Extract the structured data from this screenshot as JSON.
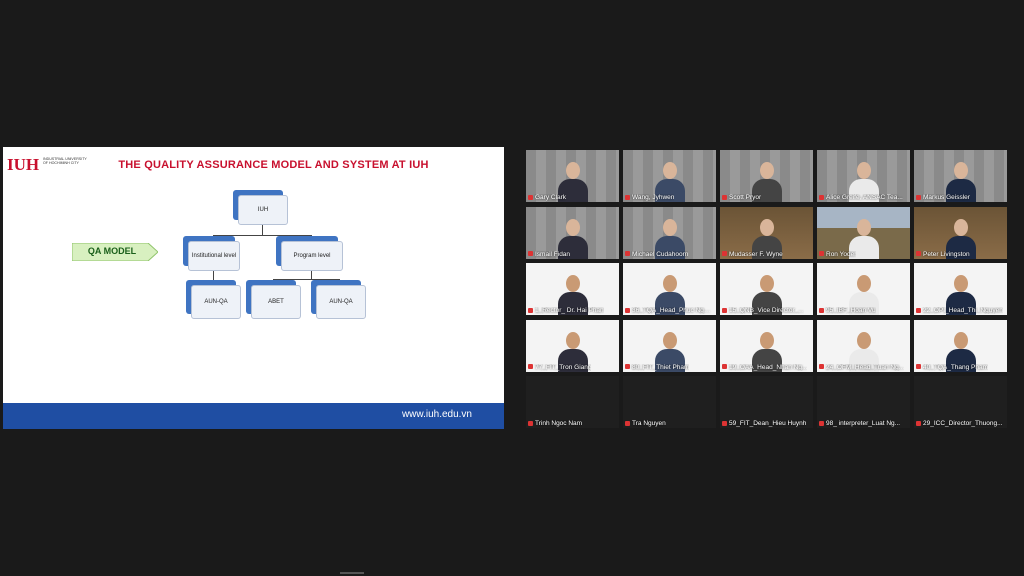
{
  "slide": {
    "title": "THE QUALITY ASSURANCE MODEL AND  SYSTEM AT IUH",
    "logo_text": "INDUSTRIAL UNIVERSITY OF HOCHIMINH CITY",
    "logo_mark": "IUH",
    "qa_model": "QA MODEL",
    "boxes": {
      "root": "IUH",
      "institutional": "Institutional level",
      "program": "Program level",
      "aun_left": "AUN-QA",
      "abet": "ABET",
      "aun_right": "AUN-QA"
    },
    "footer": "www.iuh.edu.vn"
  },
  "participants": [
    {
      "name": "Gary Clark",
      "type": "panel"
    },
    {
      "name": "Wang, Jyhwen",
      "type": "panel"
    },
    {
      "name": "Scott Pryor",
      "type": "panel"
    },
    {
      "name": "Alice Greife, ANSAC Tea...",
      "type": "panel"
    },
    {
      "name": "Markus Geissler",
      "type": "panel"
    },
    {
      "name": "Ismail Fidan",
      "type": "panel"
    },
    {
      "name": "Michael Cudahoorn",
      "type": "panel"
    },
    {
      "name": "Mudasser F. Wyne",
      "type": "room"
    },
    {
      "name": "Ron Yoder",
      "type": "outdoor"
    },
    {
      "name": "Peter Livingston",
      "type": "room"
    },
    {
      "name": "1_Rector_ Dr. Hai Phan",
      "type": "iuh"
    },
    {
      "name": "36_TQA_Head_Phuc Nguyen",
      "type": "iuh"
    },
    {
      "name": "15_QNB_Vice Director_...",
      "type": "iuh"
    },
    {
      "name": "95_IBF_Hoan Vu",
      "type": "iuh"
    },
    {
      "name": "22_OPI_Head_Thi_Nguyen",
      "type": "iuh"
    },
    {
      "name": "77_FIT_Tron Giang",
      "type": "iuh"
    },
    {
      "name": "80_FIT_Thiet Pham",
      "type": "iuh"
    },
    {
      "name": "19_OAA_Head_Nhan Ng...",
      "type": "iuh"
    },
    {
      "name": "24_OFM_Head_Tuan Ng...",
      "type": "iuh"
    },
    {
      "name": "40_TQA_Thang Pham",
      "type": "iuh"
    },
    {
      "name": "Trinh Ngoc Nam",
      "type": "off"
    },
    {
      "name": "Tra Nguyen",
      "type": "off"
    },
    {
      "name": "59_FIT_Dean_Hieu Huynh",
      "type": "off"
    },
    {
      "name": "98_ interpreter_Luat Ng...",
      "type": "off"
    },
    {
      "name": "29_ICC_Director_Thuong...",
      "type": "off"
    }
  ],
  "colors": {
    "active_outline": "#9bdc3a",
    "footer_blue": "#1f4ea3",
    "title_red": "#c8102e"
  }
}
